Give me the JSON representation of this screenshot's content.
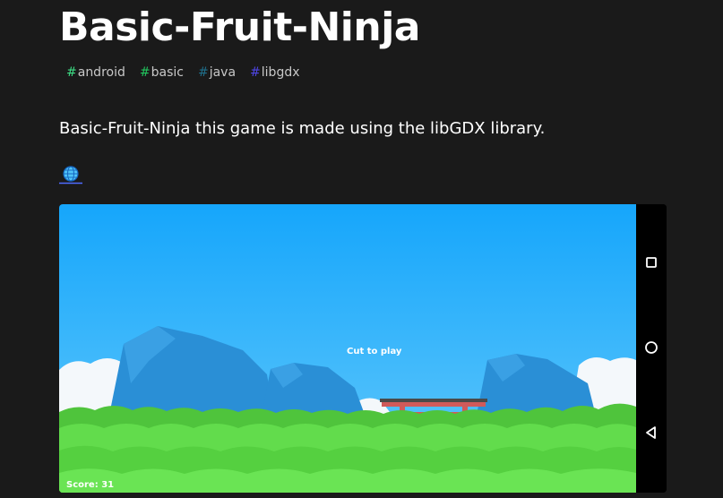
{
  "page": {
    "title": "Basic-Fruit-Ninja",
    "description": "Basic-Fruit-Ninja this game is made using the libGDX library."
  },
  "tags": [
    {
      "label": "android",
      "color": "#3ddc84"
    },
    {
      "label": "basic",
      "color": "#22c55e"
    },
    {
      "label": "java",
      "color": "#1f6f8b"
    },
    {
      "label": "libgdx",
      "color": "#4f46e5"
    }
  ],
  "website_link": {
    "icon": "globe-icon"
  },
  "screenshot": {
    "game": {
      "prompt": "Cut to play",
      "score": "Score: 31"
    },
    "nav_buttons": [
      "recents-icon",
      "home-icon",
      "back-icon"
    ]
  },
  "colors": {
    "background": "#1a1a1a",
    "text": "#ffffff",
    "sky": "#1da9f7",
    "mountain": "#2a8fd6",
    "grass": "#62dc4c",
    "gate": "#d05a5a"
  }
}
